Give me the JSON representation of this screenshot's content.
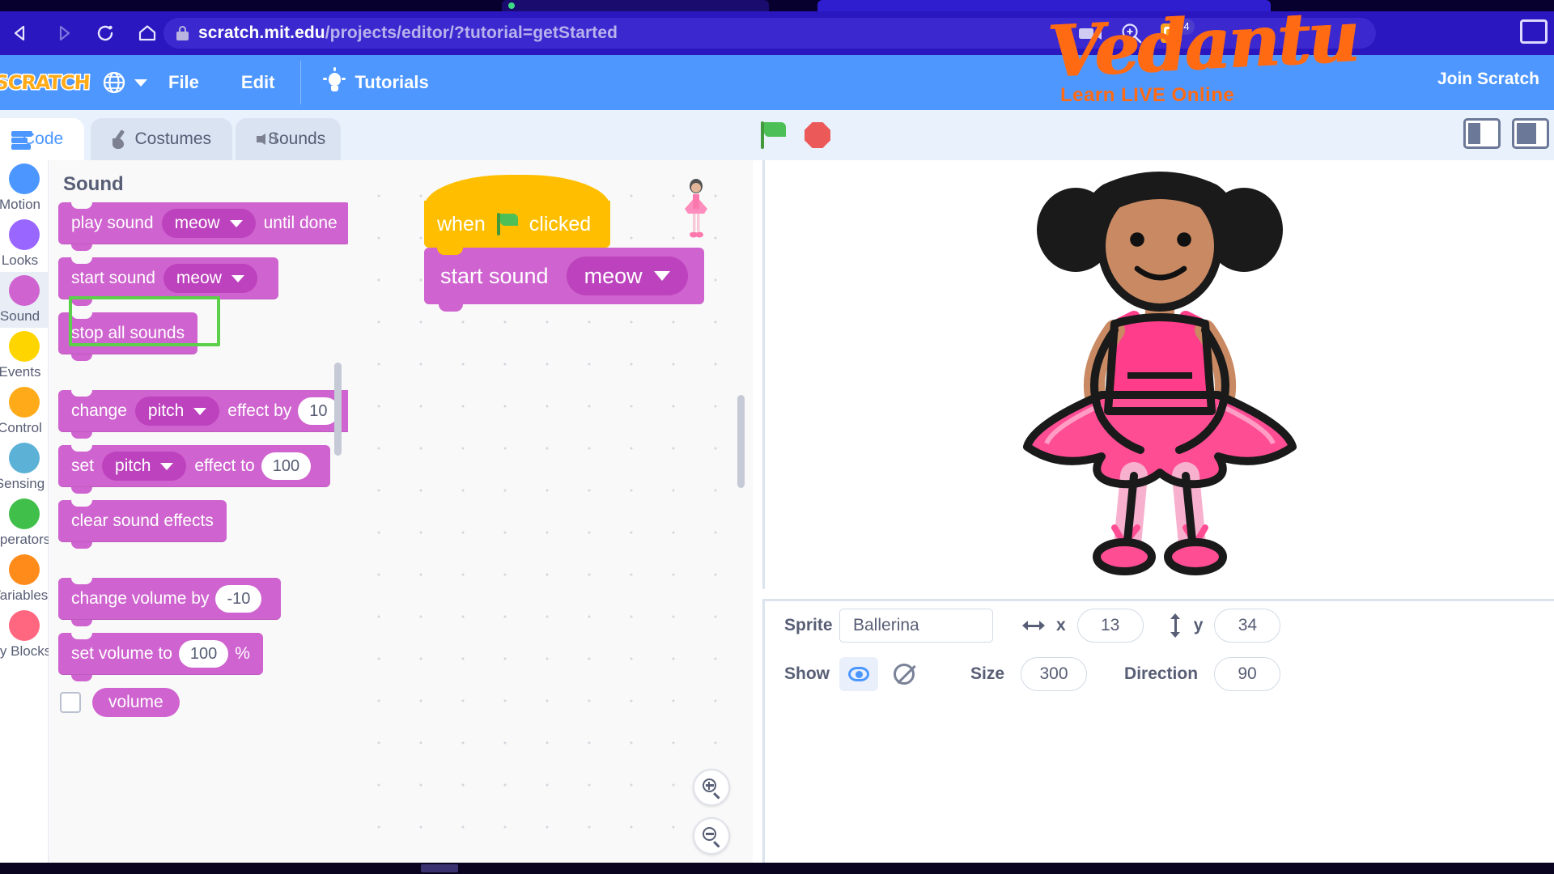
{
  "browser": {
    "url_domain": "scratch.mit.edu",
    "url_path": "/projects/editor/?tutorial=getStarted",
    "nav": {
      "back_icon": "back-arrow-icon",
      "forward_icon": "forward-arrow-icon",
      "reload_icon": "reload-icon",
      "home_icon": "home-icon",
      "bookmark_icon": "bookmark-icon",
      "lock_icon": "lock-icon"
    },
    "actions": {
      "camera_icon": "video-camera-icon",
      "zoom_icon": "zoom-magnifier-icon",
      "extension_icon": "extension-puzzle-icon",
      "extension_badge": "4",
      "window_icon": "window-controls-icon"
    }
  },
  "watermark": {
    "brand": "Vedantu",
    "tagline": "Learn LIVE Online",
    "color": "#ff6a13"
  },
  "menubar": {
    "logo": "SCRATCH",
    "globe_icon": "globe-icon",
    "items": [
      {
        "label": "File"
      },
      {
        "label": "Edit"
      }
    ],
    "tutorials": {
      "label": "Tutorials",
      "icon": "lightbulb-icon"
    },
    "join": "Join Scratch"
  },
  "editor_tabs": [
    {
      "label": "Code",
      "icon": "code-blocks-icon",
      "active": true
    },
    {
      "label": "Costumes",
      "icon": "paintbrush-icon",
      "active": false
    },
    {
      "label": "Sounds",
      "icon": "speaker-icon",
      "active": false
    }
  ],
  "stage_controls": {
    "green_flag_icon": "green-flag-icon",
    "stop_icon": "stop-sign-icon",
    "layout_small_icon": "small-stage-layout-icon",
    "layout_large_icon": "large-stage-layout-icon"
  },
  "categories": [
    {
      "label": "Motion",
      "color": "#4c97ff",
      "selected": false
    },
    {
      "label": "Looks",
      "color": "#9966ff",
      "selected": false
    },
    {
      "label": "Sound",
      "color": "#cf63cf",
      "selected": true
    },
    {
      "label": "Events",
      "color": "#ffd500",
      "selected": false
    },
    {
      "label": "Control",
      "color": "#ffab19",
      "selected": false
    },
    {
      "label": "Sensing",
      "color": "#5cb1d6",
      "selected": false
    },
    {
      "label": "Operators",
      "color": "#40bf4a",
      "selected": false
    },
    {
      "label": "Variables",
      "color": "#ff8c1a",
      "selected": false
    },
    {
      "label": "My Blocks",
      "color": "#ff6680",
      "selected": false
    }
  ],
  "palette": {
    "heading": "Sound",
    "blocks": [
      {
        "id": "play-sound-until-done",
        "pre": "play sound",
        "dropdown": "meow",
        "post": "until done"
      },
      {
        "id": "start-sound",
        "pre": "start sound",
        "dropdown": "meow",
        "post": ""
      },
      {
        "id": "stop-all-sounds",
        "pre": "stop all sounds",
        "dropdown": null,
        "post": "",
        "highlighted": true
      },
      {
        "id": "change-effect-by",
        "pre": "change",
        "dropdown": "pitch",
        "post": "effect by",
        "value": "10"
      },
      {
        "id": "set-effect-to",
        "pre": "set",
        "dropdown": "pitch",
        "post": "effect to",
        "value": "100"
      },
      {
        "id": "clear-sound-effects",
        "pre": "clear sound effects",
        "dropdown": null,
        "post": ""
      },
      {
        "id": "change-volume-by",
        "pre": "change volume by",
        "dropdown": null,
        "post": "",
        "value": "-10"
      },
      {
        "id": "set-volume-to",
        "pre": "set volume to",
        "dropdown": null,
        "post": "%",
        "value": "100"
      }
    ],
    "reporter": {
      "label": "volume",
      "checked": false
    },
    "highlight_color": "#5cd04a"
  },
  "workspace": {
    "script": [
      {
        "id": "when-flag-clicked",
        "pre": "when",
        "icon": "green-flag-icon",
        "post": "clicked",
        "type": "hat"
      },
      {
        "id": "start-sound",
        "pre": "start sound",
        "dropdown": "meow",
        "type": "stack"
      }
    ],
    "zoom_in_icon": "zoom-in-icon",
    "zoom_out_icon": "zoom-out-icon"
  },
  "sprite_panel": {
    "sprite_label": "Sprite",
    "sprite_name": "Ballerina",
    "x_label": "x",
    "x_value": "13",
    "y_label": "y",
    "y_value": "34",
    "show_label": "Show",
    "show_on_icon": "eye-visible-icon",
    "show_off_icon": "eye-hidden-icon",
    "size_label": "Size",
    "size_value": "300",
    "direction_label": "Direction",
    "direction_value": "90"
  }
}
